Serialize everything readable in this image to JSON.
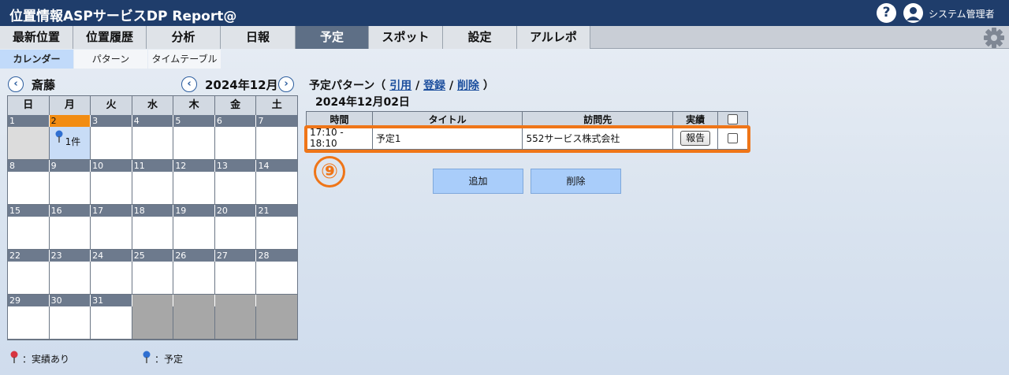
{
  "header": {
    "title": "位置情報ASPサービスDP Report@",
    "help_label": "?",
    "user_name": "システム管理者"
  },
  "nav": {
    "tabs": [
      "最新位置",
      "位置履歴",
      "分析",
      "日報",
      "予定",
      "スポット",
      "設定",
      "アルレポ"
    ],
    "active": "予定"
  },
  "subnav": {
    "tabs": [
      "カレンダー",
      "パターン",
      "タイムテーブル"
    ],
    "active": "カレンダー"
  },
  "calendar": {
    "prev_symbol": "‹",
    "next_symbol": "›",
    "user": "斎藤",
    "month": "2024年12月",
    "weekdays": [
      "日",
      "月",
      "火",
      "水",
      "木",
      "金",
      "土"
    ],
    "weeks": [
      [
        "1",
        "2",
        "3",
        "4",
        "5",
        "6",
        "7"
      ],
      [
        "8",
        "9",
        "10",
        "11",
        "12",
        "13",
        "14"
      ],
      [
        "15",
        "16",
        "17",
        "18",
        "19",
        "20",
        "21"
      ],
      [
        "22",
        "23",
        "24",
        "25",
        "26",
        "27",
        "28"
      ],
      [
        "29",
        "30",
        "31",
        "",
        "",
        "",
        ""
      ]
    ],
    "today": "2",
    "event_day": "2",
    "event_count": "1件"
  },
  "legend": {
    "actual": "：実績あり",
    "planned": "：予定"
  },
  "pattern": {
    "label": "予定パターン（",
    "cite": "引用",
    "sep": "/",
    "register": "登録",
    "delete": "削除",
    "close": "）"
  },
  "selected_date": "2024年12月02日",
  "table": {
    "headers": [
      "時間",
      "タイトル",
      "訪問先",
      "実績",
      ""
    ],
    "rows": [
      {
        "time": "17:10 - 18:10",
        "title": "予定1",
        "destination": "552サービス株式会社",
        "report_label": "報告"
      }
    ]
  },
  "callout": "⑨",
  "actions": {
    "add": "追加",
    "delete": "削除"
  },
  "colors": {
    "header": "#1f3d6b",
    "active_tab": "#5e6f86",
    "highlight": "#ef7518",
    "today": "#f28c12"
  }
}
